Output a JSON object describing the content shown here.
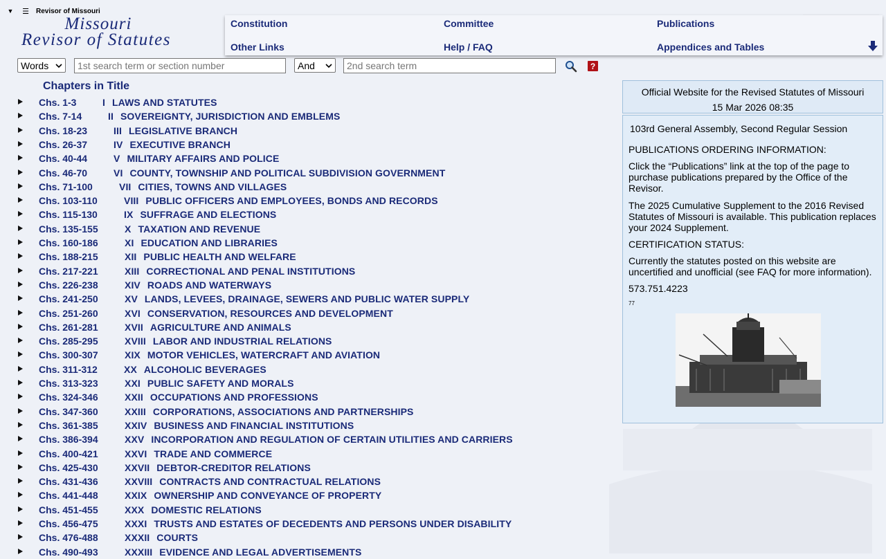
{
  "topbar": {
    "collapse_glyph": "▼",
    "menu_glyph": "☰",
    "site_name": "Revisor of Missouri"
  },
  "logo": {
    "line1": "Missouri",
    "line2": "Revisor of Statutes"
  },
  "nav": {
    "constitution": "Constitution",
    "committee": "Committee",
    "publications": "Publications",
    "other_links": "Other Links",
    "help_faq": "Help / FAQ",
    "appendices": "Appendices and Tables",
    "more_icon": "down-arrow-icon"
  },
  "search": {
    "mode_value": "Words",
    "term1_placeholder": "1st search term or section number",
    "operator_value": "And",
    "term2_placeholder": "2nd search term",
    "search_icon": "magnifier-icon",
    "help_label": "?"
  },
  "chapters_heading": "Chapters in Title",
  "chapters": [
    {
      "chs": "Chs. 1-3",
      "roman": "I",
      "title": "LAWS AND STATUTES"
    },
    {
      "chs": "Chs. 7-14",
      "roman": "II",
      "title": "SOVEREIGNTY, JURISDICTION AND EMBLEMS"
    },
    {
      "chs": "Chs. 18-23",
      "roman": "III",
      "title": "LEGISLATIVE BRANCH"
    },
    {
      "chs": "Chs. 26-37",
      "roman": "IV",
      "title": "EXECUTIVE BRANCH"
    },
    {
      "chs": "Chs. 40-44",
      "roman": "V",
      "title": "MILITARY AFFAIRS AND POLICE"
    },
    {
      "chs": "Chs. 46-70",
      "roman": "VI",
      "title": "COUNTY, TOWNSHIP AND POLITICAL SUBDIVISION GOVERNMENT"
    },
    {
      "chs": "Chs. 71-100",
      "roman": "VII",
      "title": "CITIES, TOWNS AND VILLAGES"
    },
    {
      "chs": "Chs. 103-110",
      "roman": "VIII",
      "title": "PUBLIC OFFICERS AND EMPLOYEES, BONDS AND RECORDS"
    },
    {
      "chs": "Chs. 115-130",
      "roman": "IX",
      "title": "SUFFRAGE AND ELECTIONS"
    },
    {
      "chs": "Chs. 135-155",
      "roman": "X",
      "title": "TAXATION AND REVENUE"
    },
    {
      "chs": "Chs. 160-186",
      "roman": "XI",
      "title": "EDUCATION AND LIBRARIES"
    },
    {
      "chs": "Chs. 188-215",
      "roman": "XII",
      "title": "PUBLIC HEALTH AND WELFARE"
    },
    {
      "chs": "Chs. 217-221",
      "roman": "XIII",
      "title": "CORRECTIONAL AND PENAL INSTITUTIONS"
    },
    {
      "chs": "Chs. 226-238",
      "roman": "XIV",
      "title": "ROADS AND WATERWAYS"
    },
    {
      "chs": "Chs. 241-250",
      "roman": "XV",
      "title": "LANDS, LEVEES, DRAINAGE, SEWERS AND PUBLIC WATER SUPPLY"
    },
    {
      "chs": "Chs. 251-260",
      "roman": "XVI",
      "title": "CONSERVATION, RESOURCES AND DEVELOPMENT"
    },
    {
      "chs": "Chs. 261-281",
      "roman": "XVII",
      "title": "AGRICULTURE AND ANIMALS"
    },
    {
      "chs": "Chs. 285-295",
      "roman": "XVIII",
      "title": "LABOR AND INDUSTRIAL RELATIONS"
    },
    {
      "chs": "Chs. 300-307",
      "roman": "XIX",
      "title": "MOTOR VEHICLES, WATERCRAFT AND AVIATION"
    },
    {
      "chs": "Chs. 311-312",
      "roman": "XX",
      "title": "ALCOHOLIC BEVERAGES"
    },
    {
      "chs": "Chs. 313-323",
      "roman": "XXI",
      "title": "PUBLIC SAFETY AND MORALS"
    },
    {
      "chs": "Chs. 324-346",
      "roman": "XXII",
      "title": "OCCUPATIONS AND PROFESSIONS"
    },
    {
      "chs": "Chs. 347-360",
      "roman": "XXIII",
      "title": "CORPORATIONS, ASSOCIATIONS AND PARTNERSHIPS"
    },
    {
      "chs": "Chs. 361-385",
      "roman": "XXIV",
      "title": "BUSINESS AND FINANCIAL INSTITUTIONS"
    },
    {
      "chs": "Chs. 386-394",
      "roman": "XXV",
      "title": "INCORPORATION AND REGULATION OF CERTAIN UTILITIES AND CARRIERS"
    },
    {
      "chs": "Chs. 400-421",
      "roman": "XXVI",
      "title": "TRADE AND COMMERCE"
    },
    {
      "chs": "Chs. 425-430",
      "roman": "XXVII",
      "title": "DEBTOR-CREDITOR RELATIONS"
    },
    {
      "chs": "Chs. 431-436",
      "roman": "XXVIII",
      "title": "CONTRACTS AND CONTRACTUAL RELATIONS"
    },
    {
      "chs": "Chs. 441-448",
      "roman": "XXIX",
      "title": "OWNERSHIP AND CONVEYANCE OF PROPERTY"
    },
    {
      "chs": "Chs. 451-455",
      "roman": "XXX",
      "title": "DOMESTIC RELATIONS"
    },
    {
      "chs": "Chs. 456-475",
      "roman": "XXXI",
      "title": "TRUSTS AND ESTATES OF DECEDENTS AND PERSONS UNDER DISABILITY"
    },
    {
      "chs": "Chs. 476-488",
      "roman": "XXXII",
      "title": "COURTS"
    },
    {
      "chs": "Chs. 490-493",
      "roman": "XXXIII",
      "title": "EVIDENCE AND LEGAL ADVERTISEMENTS"
    }
  ],
  "panel": {
    "official": "Official Website for the Revised Statutes of Missouri",
    "datetime": "15 Mar 2026 08:35",
    "session": "103rd General Assembly, Second Regular Session",
    "pub_heading": "PUBLICATIONS ORDERING INFORMATION:",
    "pub_text": "Click the “Publications” link at the top of the page to purchase publications prepared by the Office of the Revisor.",
    "supplement_text": "The 2025 Cumulative Supplement to the 2016 Revised Statutes of Missouri is available. This publication replaces your 2024 Supplement.",
    "cert_heading": "CERTIFICATION STATUS:",
    "cert_text": "Currently the statutes posted on this website are uncertified and unofficial (see FAQ for more information).",
    "phone": "573.751.4223",
    "tiny": "77",
    "photo_icon": "capitol-construction-photo"
  },
  "colors": {
    "link": "#1a2a78",
    "panel_bg": "#e2edf8",
    "panel_border": "#9fc0dc",
    "help_red": "#b01217"
  }
}
